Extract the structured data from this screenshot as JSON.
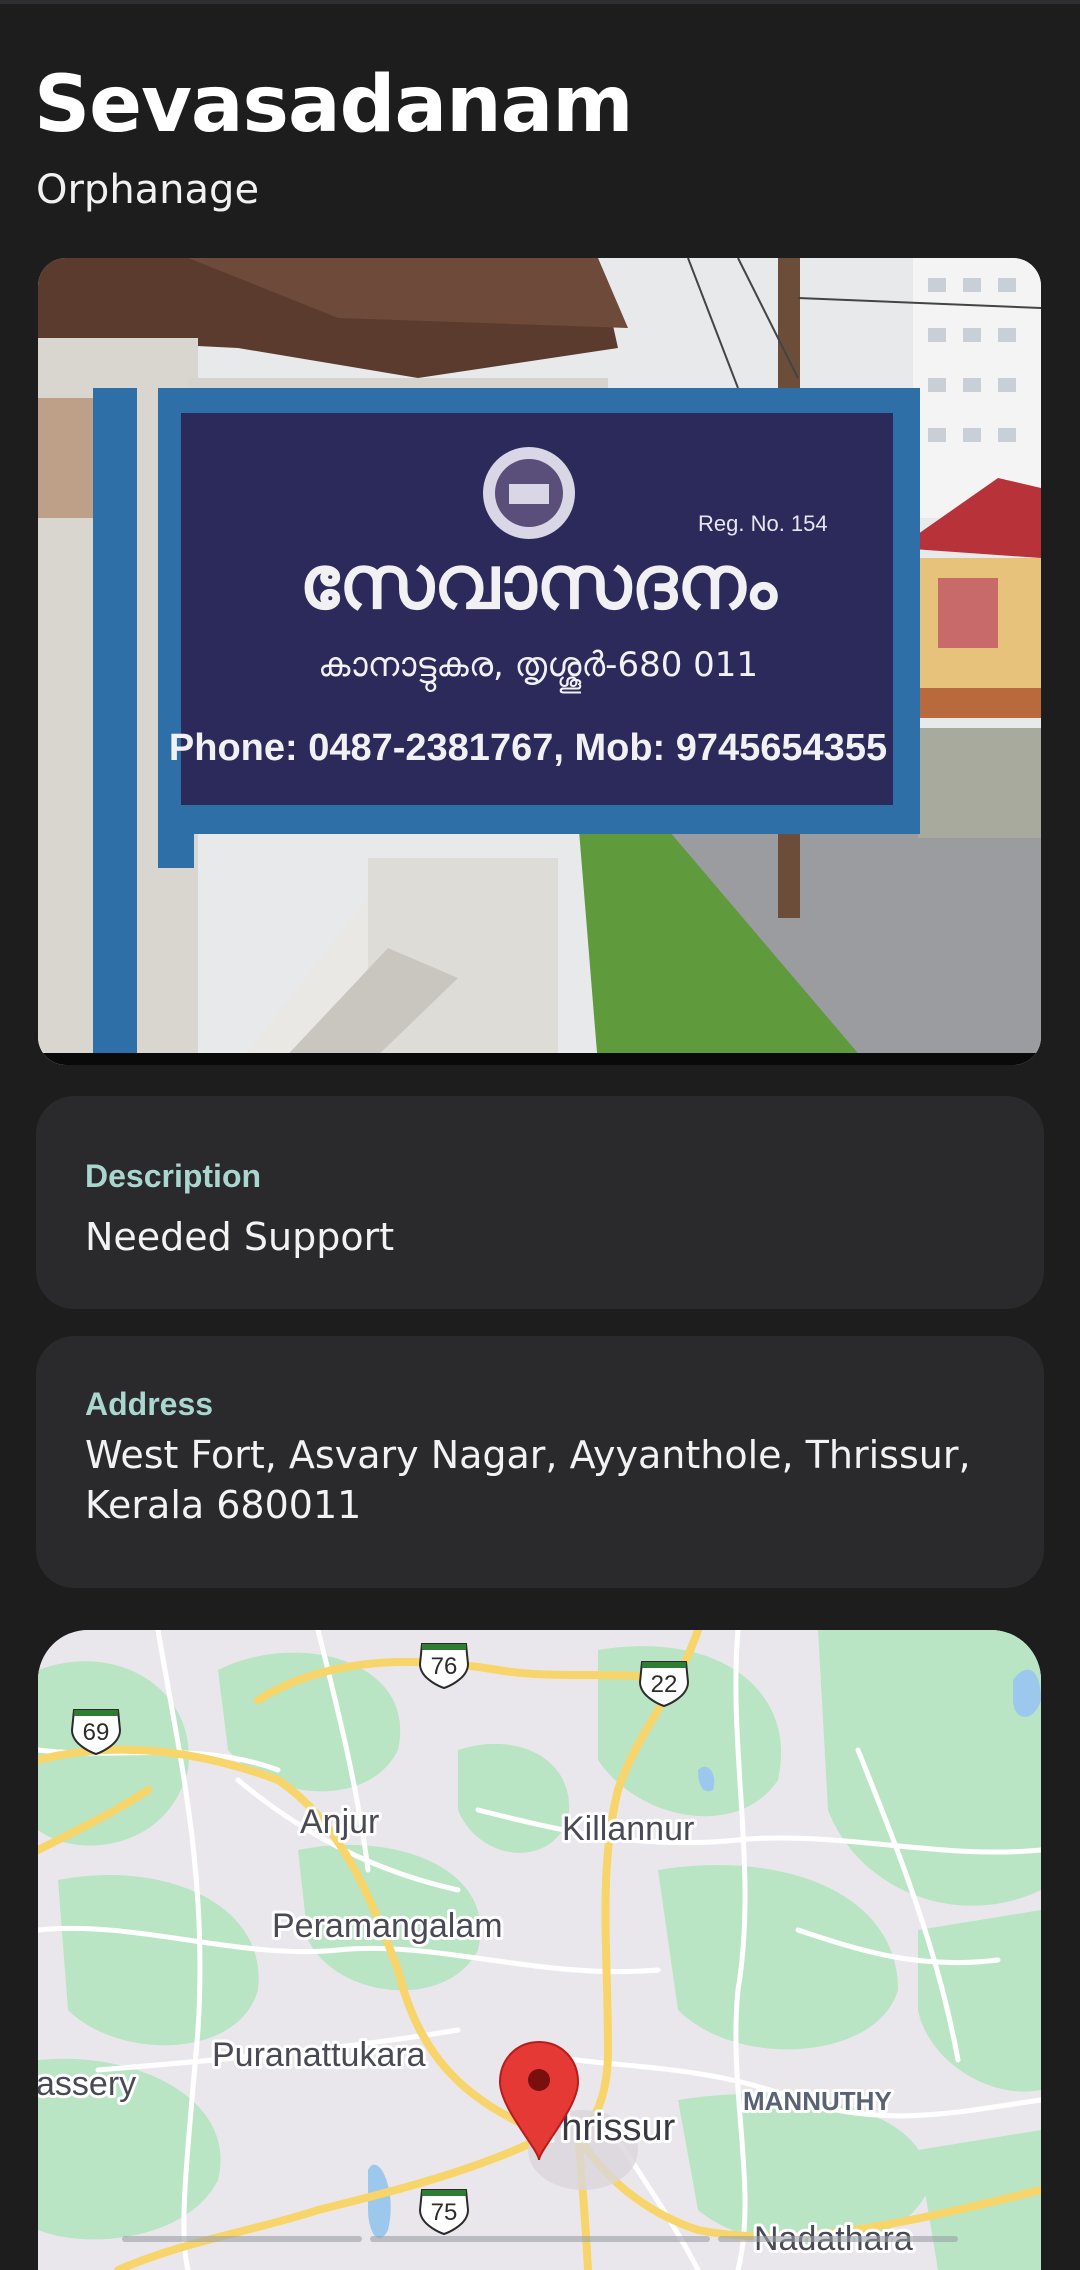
{
  "header": {
    "title": "Sevasadanam",
    "subtitle": "Orphanage"
  },
  "photo": {
    "sign_malayalam": "സേവാസദനം",
    "sign_place": "കാനാട്ടുകര, തൃശ്ശൂർ-680 011",
    "sign_reg": "Reg. No. 154",
    "sign_phone": "Phone: 0487-2381767, Mob: 9745654355"
  },
  "description": {
    "label": "Description",
    "value": "Needed Support"
  },
  "address": {
    "label": "Address",
    "value": "West Fort, Asvary Nagar, Ayyanthole, Thrissur, Kerala 680011"
  },
  "map": {
    "places": {
      "anjur": "Anjur",
      "killannur": "Killannur",
      "peramangalam": "Peramangalam",
      "puranattukara": "Puranattukara",
      "assery": "assery",
      "thrissur": "Thrissur",
      "mannuthy": "MANNUTHY",
      "nadathara": "Nadathara"
    },
    "routes": {
      "r76": "76",
      "r22": "22",
      "r69": "69",
      "r75": "75"
    },
    "pin_icon": "map-pin-icon",
    "colors": {
      "land": "#eae7ec",
      "green": "#b9e5c4",
      "road_major": "#f7d56a",
      "pin": "#e53935"
    }
  }
}
